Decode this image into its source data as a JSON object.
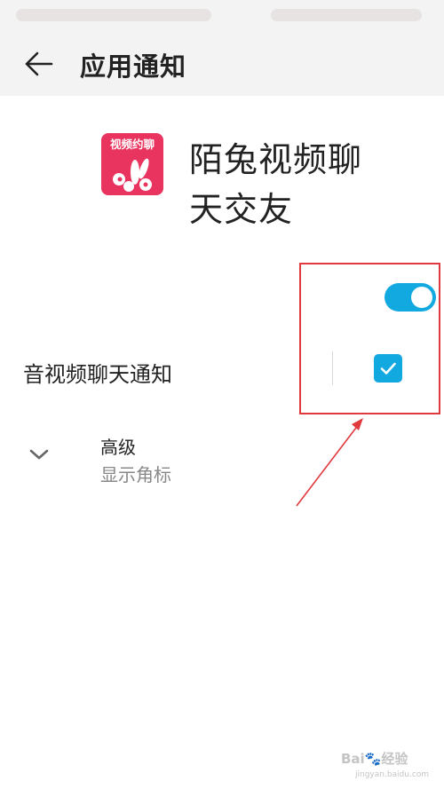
{
  "header": {
    "title": "应用通知",
    "back_icon": "arrow-left-icon"
  },
  "app": {
    "name_line1": "陌兔视频聊",
    "name_line2": "天交友",
    "icon_text": "视频约聊",
    "icon_color": "#e8345f"
  },
  "main_switch": {
    "state": "on",
    "color": "#12a8e0"
  },
  "channel": {
    "label": "音视频聊天通知",
    "checked": true
  },
  "advanced": {
    "title": "高级",
    "subtitle": "显示角标",
    "chevron_icon": "chevron-down-icon"
  },
  "annotation": {
    "color": "#e0393e"
  },
  "watermark": {
    "text": "Bai🐾经验",
    "url": "jingyan.baidu.com"
  }
}
